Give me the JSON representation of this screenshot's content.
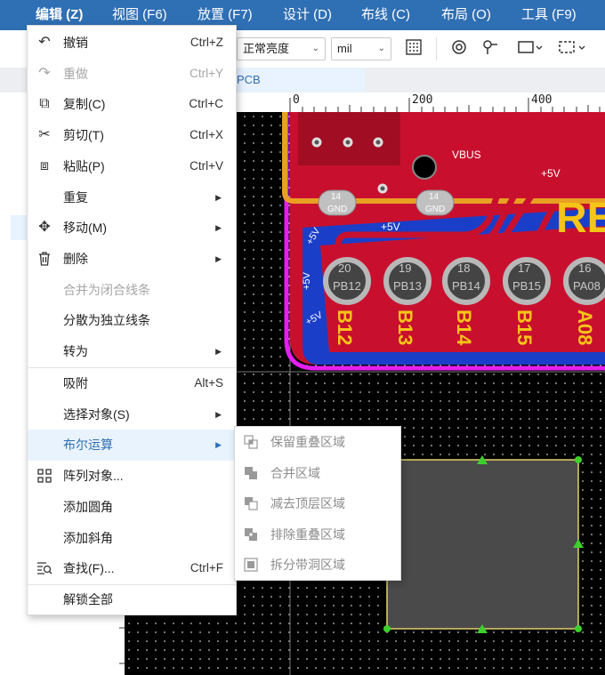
{
  "menubar": {
    "items": [
      {
        "label": "编辑 (Z)",
        "active": true
      },
      {
        "label": "视图 (F6)"
      },
      {
        "label": "放置 (F7)"
      },
      {
        "label": "设计 (D)"
      },
      {
        "label": "布线 (C)"
      },
      {
        "label": "布局 (O)"
      },
      {
        "label": "工具 (F9)"
      }
    ]
  },
  "toolbar": {
    "brightness": "正常亮度",
    "unit": "mil",
    "icons": [
      "grid-icon",
      "via-icon",
      "pin-icon",
      "select-box-icon",
      "select-area-icon"
    ]
  },
  "tabs": {
    "pcb": "PCB"
  },
  "ruler": {
    "ticks": [
      "0",
      "200",
      "400"
    ]
  },
  "edit_menu": {
    "items": [
      {
        "icon": "undo-icon",
        "label": "撤销",
        "shortcut": "Ctrl+Z"
      },
      {
        "icon": "redo-icon",
        "label": "重做",
        "shortcut": "Ctrl+Y",
        "disabled": true
      },
      {
        "icon": "copy-icon",
        "label": "复制(C)",
        "shortcut": "Ctrl+C"
      },
      {
        "icon": "cut-icon",
        "label": "剪切(T)",
        "shortcut": "Ctrl+X"
      },
      {
        "icon": "paste-icon",
        "label": "粘贴(P)",
        "shortcut": "Ctrl+V"
      },
      {
        "label": "重复",
        "submenu": true
      },
      {
        "icon": "move-icon",
        "label": "移动(M)",
        "submenu": true
      },
      {
        "icon": "trash-icon",
        "label": "删除",
        "submenu": true
      },
      {
        "label": "合并为闭合线条",
        "disabled": true
      },
      {
        "label": "分散为独立线条"
      },
      {
        "label": "转为",
        "submenu": true
      },
      {
        "label": "吸附",
        "shortcut": "Alt+S"
      },
      {
        "label": "选择对象(S)",
        "submenu": true
      },
      {
        "label": "布尔运算",
        "submenu": true,
        "highlighted": true
      },
      {
        "icon": "array-icon",
        "label": "阵列对象..."
      },
      {
        "label": "添加圆角"
      },
      {
        "label": "添加斜角"
      },
      {
        "icon": "find-icon",
        "label": "查找(F)...",
        "shortcut": "Ctrl+F"
      },
      {
        "label": "解锁全部"
      }
    ]
  },
  "boolean_submenu": {
    "items": [
      {
        "icon": "keep-overlap-icon",
        "label": "保留重叠区域"
      },
      {
        "icon": "merge-region-icon",
        "label": "合并区域"
      },
      {
        "icon": "subtract-top-icon",
        "label": "减去顶层区域"
      },
      {
        "icon": "exclude-overlap-icon",
        "label": "排除重叠区域"
      },
      {
        "icon": "split-hole-icon",
        "label": "拆分带洞区域"
      }
    ]
  },
  "pcb": {
    "pad_labels": [
      {
        "num": "20",
        "net": "PB12"
      },
      {
        "num": "19",
        "net": "PB13"
      },
      {
        "num": "18",
        "net": "PB14"
      },
      {
        "num": "17",
        "net": "PB15"
      },
      {
        "num": "16",
        "net": "PA08"
      }
    ],
    "silk_labels": [
      "B12",
      "B13",
      "B14",
      "B15",
      "A08"
    ],
    "net_labels": [
      "+5V",
      "VBUS",
      "GND",
      "14",
      "RE"
    ],
    "colors": {
      "board": "#c8102e",
      "copper_bottom": "#1b3ec9",
      "silkscreen": "#f5c518",
      "outline": "#e61ef0",
      "track": "#e8a023"
    }
  }
}
